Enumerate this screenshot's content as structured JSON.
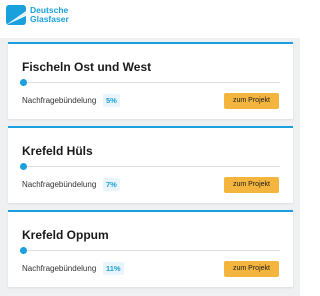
{
  "brand": {
    "name_line1": "Deutsche",
    "name_line2": "Glasfaser",
    "logo_icon": "deutsche-glasfaser-logo-icon",
    "accent_color": "#1aa0dc"
  },
  "projects": [
    {
      "title": "Fischeln Ost und West",
      "metric_label": "Nachfragebündelung",
      "percent": "5%",
      "progress_fraction": 0.05,
      "button_label": "zum Projekt"
    },
    {
      "title": "Krefeld Hüls",
      "metric_label": "Nachfragebündelung",
      "percent": "7%",
      "progress_fraction": 0.07,
      "button_label": "zum Projekt"
    },
    {
      "title": "Krefeld Oppum",
      "metric_label": "Nachfragebündelung",
      "percent": "11%",
      "progress_fraction": 0.11,
      "button_label": "zum Projekt"
    }
  ],
  "colors": {
    "button": "#f3b53d",
    "background": "#eef0f2"
  }
}
